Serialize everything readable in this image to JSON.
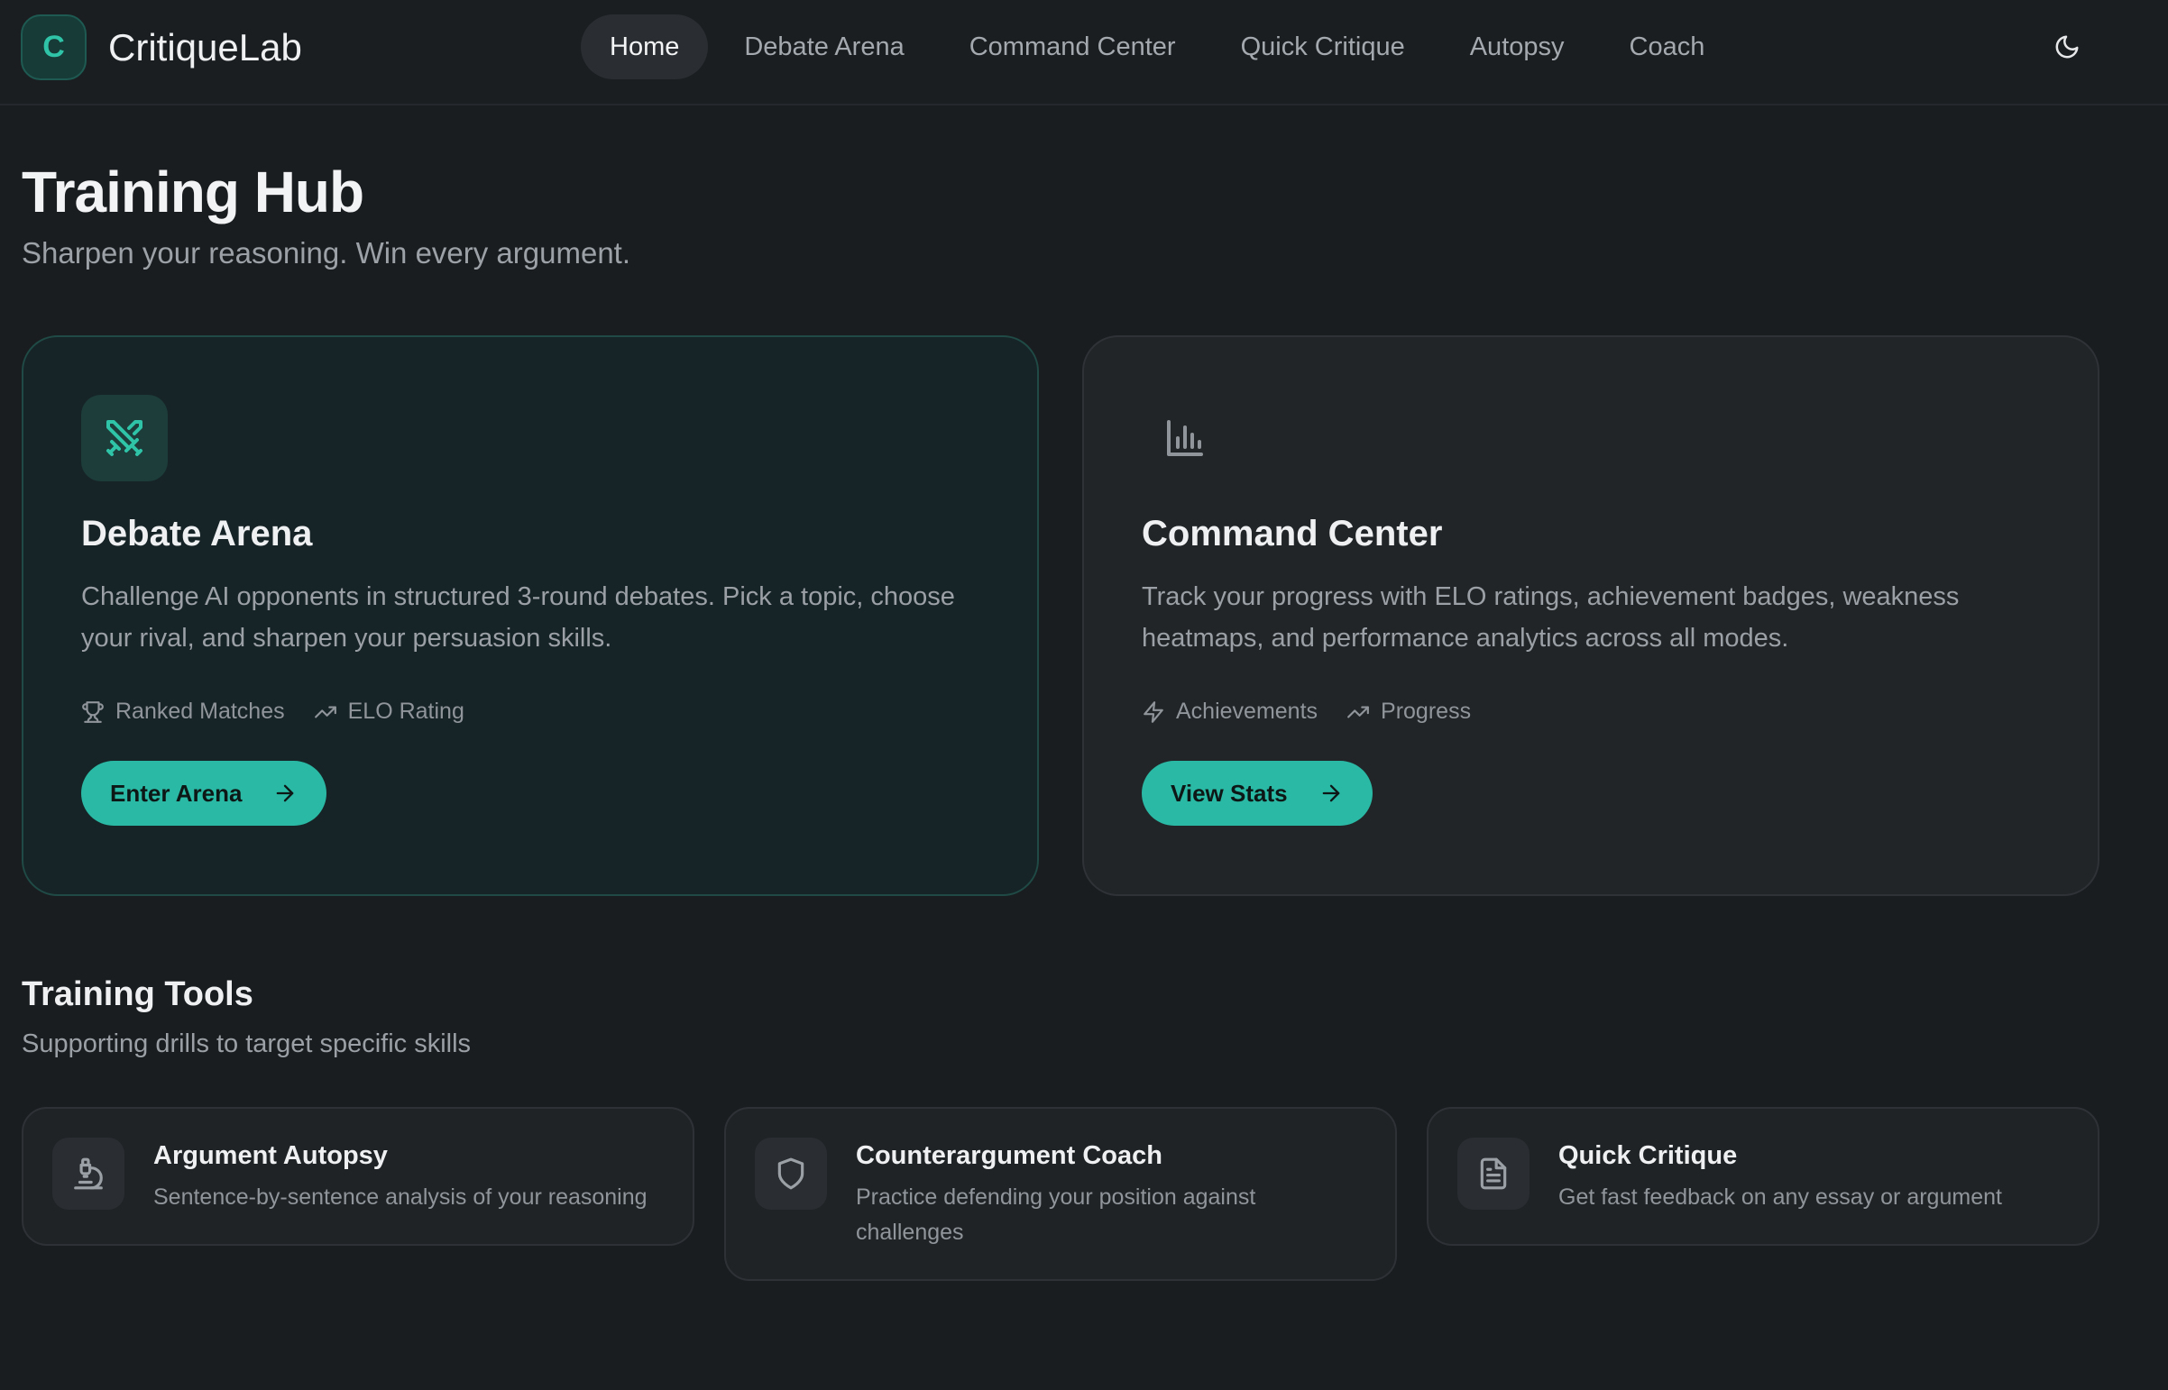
{
  "app": {
    "brand_letter": "C",
    "brand_name": "CritiqueLab"
  },
  "nav": {
    "items": [
      "Home",
      "Debate Arena",
      "Command Center",
      "Quick Critique",
      "Autopsy",
      "Coach"
    ],
    "active": "Home",
    "theme_toggle_icon": "moon-icon"
  },
  "hero": {
    "title": "Training Hub",
    "subtitle": "Sharpen your reasoning. Win every argument."
  },
  "cards": {
    "arena": {
      "icon": "crossed-swords-icon",
      "title": "Debate Arena",
      "description": "Challenge AI opponents in structured 3-round debates. Pick a topic, choose your rival, and sharpen your persuasion skills.",
      "features": [
        {
          "icon": "trophy-icon",
          "label": "Ranked Matches"
        },
        {
          "icon": "trending-up-icon",
          "label": "ELO Rating"
        }
      ],
      "cta_label": "Enter Arena"
    },
    "command": {
      "icon": "bar-chart-icon",
      "title": "Command Center",
      "description": "Track your progress with ELO ratings, achievement badges, weakness heatmaps, and performance analytics across all modes.",
      "features": [
        {
          "icon": "lightning-icon",
          "label": "Achievements"
        },
        {
          "icon": "trending-up-icon",
          "label": "Progress"
        }
      ],
      "cta_label": "View Stats"
    }
  },
  "tools": {
    "title": "Training Tools",
    "subtitle": "Supporting drills to target specific skills",
    "items": [
      {
        "icon": "microscope-icon",
        "title": "Argument Autopsy",
        "description": "Sentence-by-sentence analysis of your reasoning"
      },
      {
        "icon": "shield-icon",
        "title": "Counterargument Coach",
        "description": "Practice defending your position against challenges"
      },
      {
        "icon": "document-icon",
        "title": "Quick Critique",
        "description": "Get fast feedback on any essay or argument"
      }
    ]
  },
  "colors": {
    "accent": "#2ab9a4",
    "background": "#1a1d20",
    "card": "#222528"
  }
}
